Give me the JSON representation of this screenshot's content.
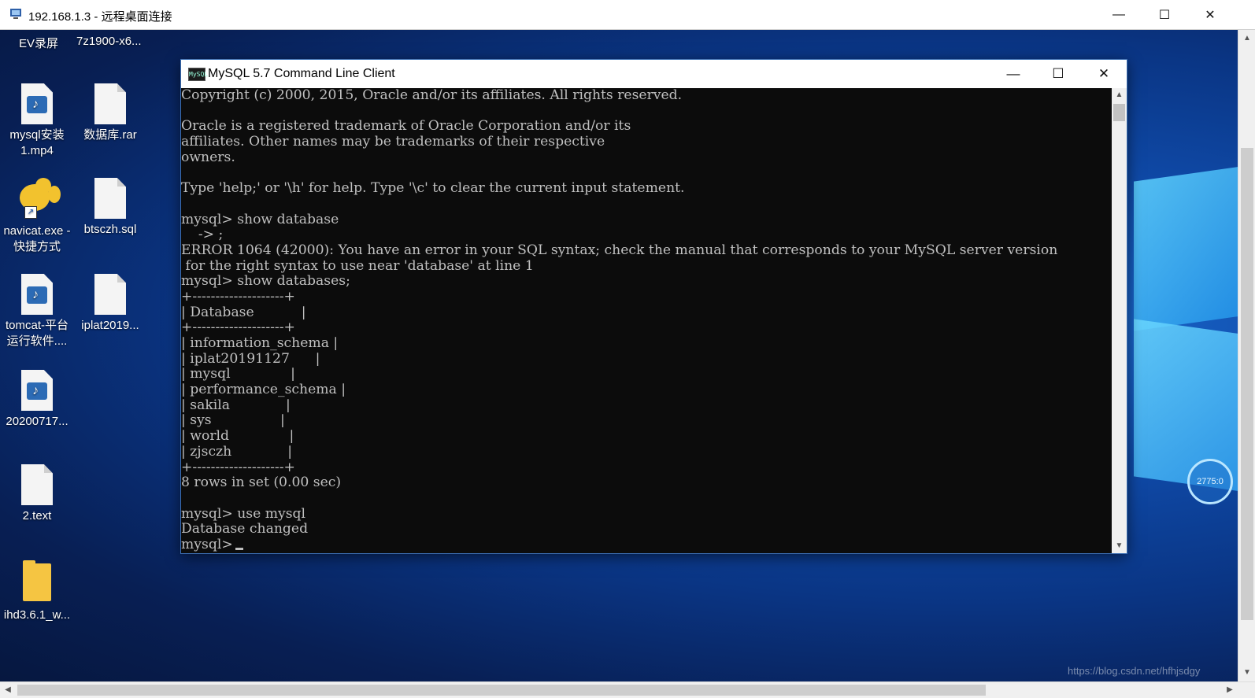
{
  "remote_window": {
    "title": "192.168.1.3 - 远程桌面连接",
    "controls": {
      "minimize": "—",
      "maximize": "☐",
      "close": "✕"
    }
  },
  "desktop": {
    "top_labels": [
      "EV录屏",
      "7z1900-x6..."
    ],
    "icons": [
      {
        "label": "mysql安装\n1.mp4",
        "icon": "video-file-icon"
      },
      {
        "label": "数据库.rar",
        "icon": "file-icon"
      },
      {
        "label": "navicat.exe -\n快捷方式",
        "icon": "navicat-icon"
      },
      {
        "label": "btsczh.sql",
        "icon": "file-icon"
      },
      {
        "label": "tomcat-平台\n运行软件....",
        "icon": "video-file-icon"
      },
      {
        "label": "iplat2019...",
        "icon": "file-icon"
      },
      {
        "label": "20200717...",
        "icon": "video-file-icon"
      },
      {
        "label": "2.text",
        "icon": "file-icon"
      },
      {
        "label": "ihd3.6.1_w...",
        "icon": "folder-icon"
      }
    ],
    "ring_text": "2775:0",
    "watermark": "https://blog.csdn.net/hfhjsdgy"
  },
  "mysql_window": {
    "title": "MySQL 5.7 Command Line Client",
    "icon_text": "MySQL",
    "controls": {
      "minimize": "—",
      "maximize": "☐",
      "close": "✕"
    },
    "console_lines": [
      "Copyright (c) 2000, 2015, Oracle and/or its affiliates. All rights reserved.",
      "",
      "Oracle is a registered trademark of Oracle Corporation and/or its",
      "affiliates. Other names may be trademarks of their respective",
      "owners.",
      "",
      "Type 'help;' or '\\h' for help. Type '\\c' to clear the current input statement.",
      "",
      "mysql> show database",
      "    -> ;",
      "ERROR 1064 (42000): You have an error in your SQL syntax; check the manual that corresponds to your MySQL server version",
      " for the right syntax to use near 'database' at line 1",
      "mysql> show databases;",
      "+--------------------+",
      "| Database           |",
      "+--------------------+",
      "| information_schema |",
      "| iplat20191127      |",
      "| mysql              |",
      "| performance_schema |",
      "| sakila             |",
      "| sys                |",
      "| world              |",
      "| zjsczh             |",
      "+--------------------+",
      "8 rows in set (0.00 sec)",
      "",
      "mysql> use mysql",
      "Database changed"
    ],
    "prompt": "mysql>"
  }
}
